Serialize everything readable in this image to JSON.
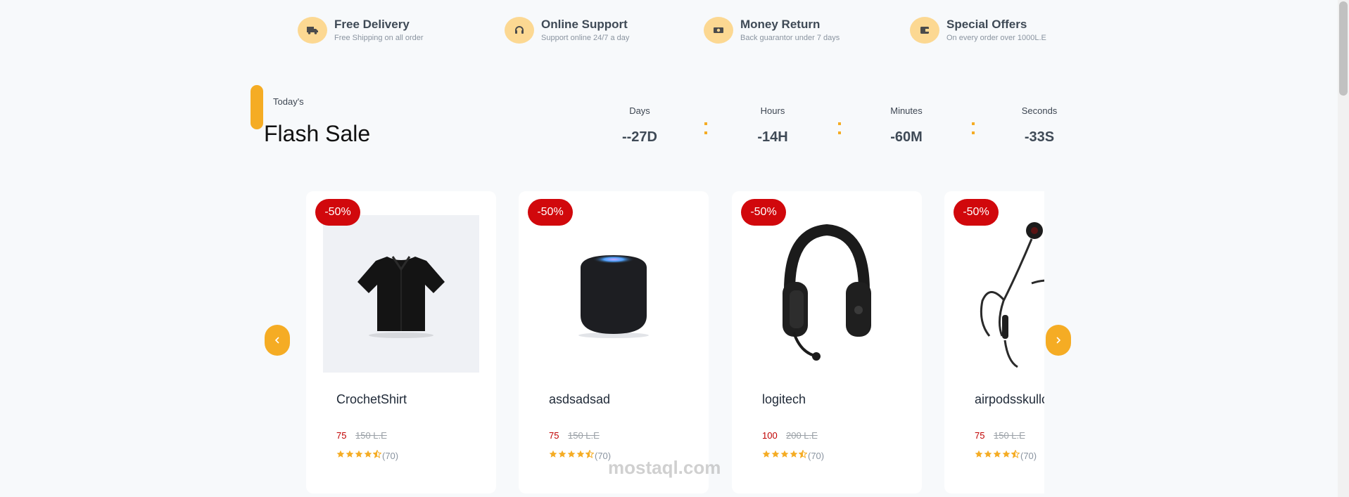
{
  "features": [
    {
      "title": "Free Delivery",
      "subtitle": "Free Shipping on all order",
      "icon": "truck-icon"
    },
    {
      "title": "Online Support",
      "subtitle": "Support online 24/7 a day",
      "icon": "headset-icon"
    },
    {
      "title": "Money Return",
      "subtitle": "Back guarantor under 7 days",
      "icon": "money-icon"
    },
    {
      "title": "Special Offers",
      "subtitle": "On every order over 1000L.E",
      "icon": "wallet-icon"
    }
  ],
  "flash_sale": {
    "eyebrow": "Today's",
    "title": "Flash Sale"
  },
  "countdown": [
    {
      "label": "Days",
      "value": "--27D"
    },
    {
      "label": "Hours",
      "value": "-14H"
    },
    {
      "label": "Minutes",
      "value": "-60M"
    },
    {
      "label": "Seconds",
      "value": "-33S"
    }
  ],
  "products": [
    {
      "name": "CrochetShirt",
      "discount": "-50%",
      "price": "75",
      "old_price": "150 L.E",
      "rating_count": "(70)",
      "rating": 4.5,
      "image": "shirt"
    },
    {
      "name": "asdsadsad",
      "discount": "-50%",
      "price": "75",
      "old_price": "150 L.E",
      "rating_count": "(70)",
      "rating": 4.5,
      "image": "speaker"
    },
    {
      "name": "logitech",
      "discount": "-50%",
      "price": "100",
      "old_price": "200 L.E",
      "rating_count": "(70)",
      "rating": 4.5,
      "image": "headphones"
    },
    {
      "name": "airpodsskullcandy",
      "discount": "-50%",
      "price": "75",
      "old_price": "150 L.E",
      "rating_count": "(70)",
      "rating": 4.5,
      "image": "earphones"
    }
  ],
  "carousel": {
    "prev_icon": "chevron-left-icon",
    "next_icon": "chevron-right-icon"
  },
  "watermark": {
    "text": "mostaql.com"
  },
  "colors": {
    "accent": "#f5ac24",
    "icon_bg": "#fcd892",
    "badge": "#d1080c",
    "price": "#c00000",
    "background": "#f7f9fb"
  }
}
